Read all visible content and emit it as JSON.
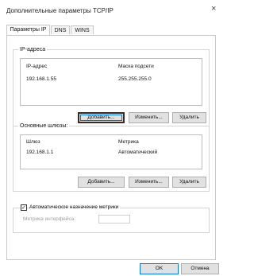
{
  "window": {
    "title": "Дополнительные параметры TCP/IP",
    "close_glyph": "×"
  },
  "tabs": [
    {
      "label": "Параметры IP",
      "active": true
    },
    {
      "label": "DNS",
      "active": false
    },
    {
      "label": "WINS",
      "active": false
    }
  ],
  "ip_group": {
    "title": "IP-адреса",
    "col_ip": "IP-адрес",
    "col_mask": "Маска подсети",
    "rows": [
      {
        "ip": "192.168.1.55",
        "mask": "255.255.255.0"
      }
    ],
    "add_label": "Добавить...",
    "edit_label": "Изменить...",
    "delete_label": "Удалить"
  },
  "gateway_group": {
    "title": "Основные шлюзы:",
    "col_gateway": "Шлюз",
    "col_metric": "Метрика",
    "rows": [
      {
        "gateway": "192.168.1.1",
        "metric": "Автоматический"
      }
    ],
    "add_label": "Добавить...",
    "edit_label": "Изменить...",
    "delete_label": "Удалить"
  },
  "auto_metric": {
    "label": "Автоматическое назначение метрики",
    "checked": true,
    "check_glyph": "✓",
    "interface_metric_label": "Метрика интерфейса:",
    "interface_metric_value": ""
  },
  "footer": {
    "ok_label": "OK",
    "cancel_label": "Отмена"
  },
  "colors": {
    "focus_border": "#3a2a26",
    "focus_ring": "#0078d7",
    "disabled_text": "#a0a0a0"
  }
}
